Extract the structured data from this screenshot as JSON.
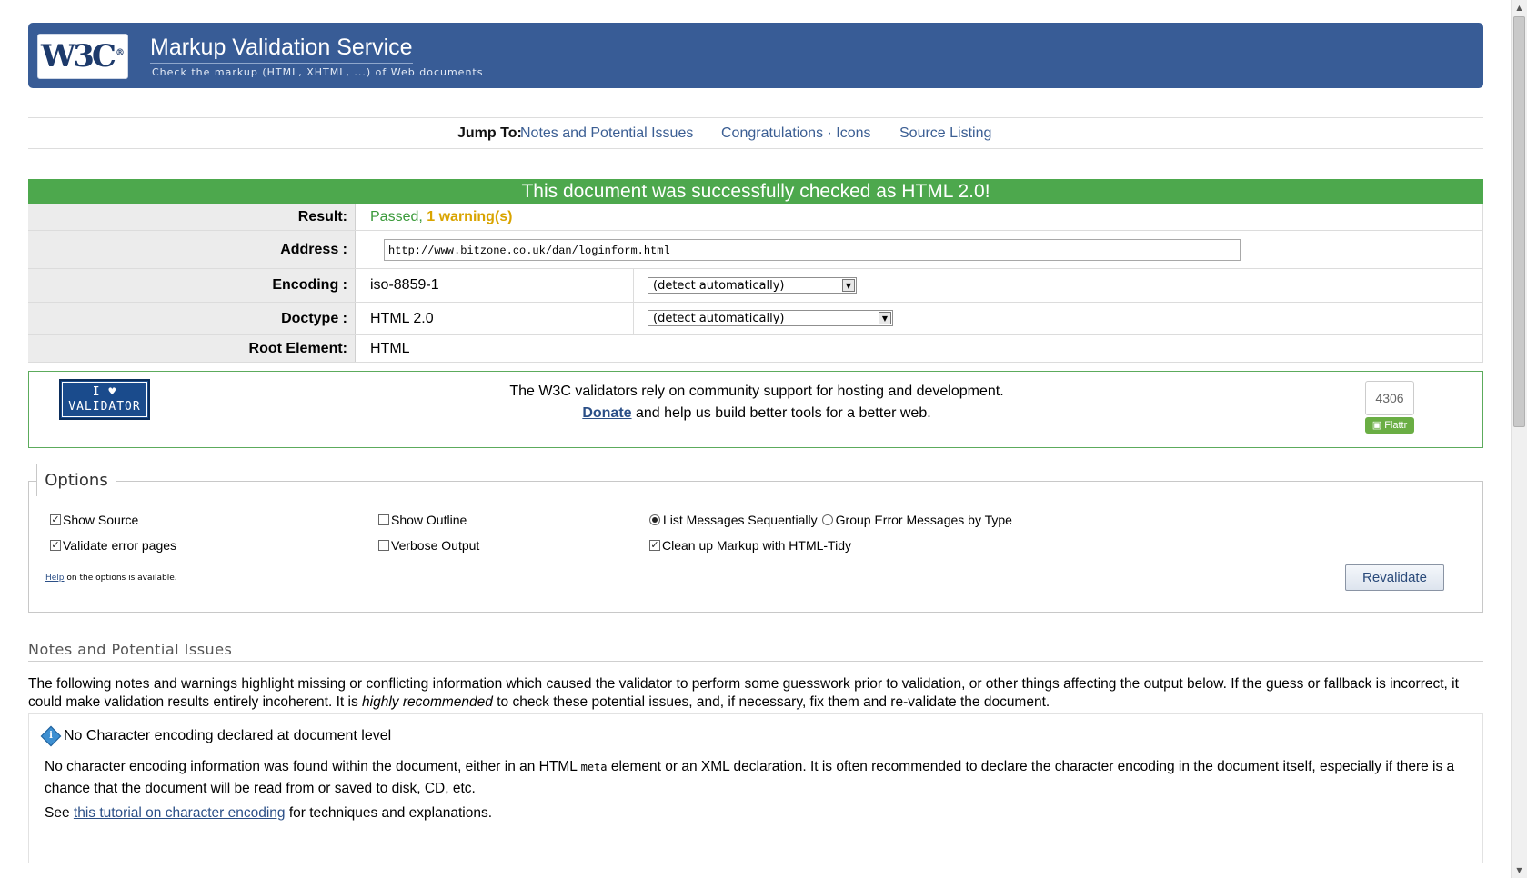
{
  "header": {
    "logo_text": "W3C",
    "logo_mark": "®",
    "title": "Markup Validation Service",
    "subtitle": "Check the markup (HTML, XHTML, ...) of Web documents"
  },
  "jumpnav": {
    "label": "Jump To:",
    "links": [
      "Notes and Potential Issues",
      "Congratulations · Icons",
      "Source Listing"
    ]
  },
  "result": {
    "banner": "This document was successfully checked as HTML 2.0!",
    "result_label": "Result:",
    "result_passed": "Passed,",
    "result_warnings": "1 warning(s)",
    "address_label": "Address :",
    "address_value": "http://www.bitzone.co.uk/dan/loginform.html",
    "encoding_label": "Encoding :",
    "encoding_value": "iso-8859-1",
    "encoding_select": "(detect automatically)",
    "doctype_label": "Doctype :",
    "doctype_value": "HTML 2.0",
    "doctype_select": "(detect automatically)",
    "root_label": "Root Element:",
    "root_value": "HTML"
  },
  "donate": {
    "badge_line1": "I ♥",
    "badge_line2": "VALIDATOR",
    "line1": "The W3C validators rely on community support for hosting and development.",
    "donate_link": "Donate",
    "line2_rest": " and help us build better tools for a better web.",
    "flattr_count": "4306",
    "flattr_label": "Flattr"
  },
  "options": {
    "legend": "Options",
    "show_source": "Show Source",
    "show_outline": "Show Outline",
    "list_sequential": "List Messages Sequentially",
    "group_by_type": "Group Error Messages by Type",
    "validate_error_pages": "Validate error pages",
    "verbose_output": "Verbose Output",
    "clean_up_tidy": "Clean up Markup with HTML-Tidy",
    "help_link": "Help",
    "help_rest": " on the options is available.",
    "revalidate": "Revalidate"
  },
  "notes": {
    "title": "Notes and Potential Issues",
    "intro_a": "The following notes and warnings highlight missing or conflicting information which caused the validator to perform some guesswork prior to validation, or other things affecting the output below. If the guess or fallback is incorrect, it could make validation results entirely incoherent. It is ",
    "intro_em": "highly recommended",
    "intro_b": " to check these potential issues, and, if necessary, fix them and re-validate the document.",
    "item_title": "No Character encoding declared at document level",
    "item_body_a": "No character encoding information was found within the document, either in an HTML ",
    "item_body_code": "meta",
    "item_body_b": " element or an XML declaration. It is often recommended to declare the character encoding in the document itself, especially if there is a chance that the document will be read from or saved to disk, CD, etc.",
    "see": "See ",
    "see_link": "this tutorial on character encoding",
    "see_rest": " for techniques and explanations."
  },
  "colors": {
    "banner": "#385c96",
    "success": "#4da84d",
    "passed_text": "#3a9a3a",
    "warning_text": "#d9a400",
    "link": "#2b4f87"
  }
}
